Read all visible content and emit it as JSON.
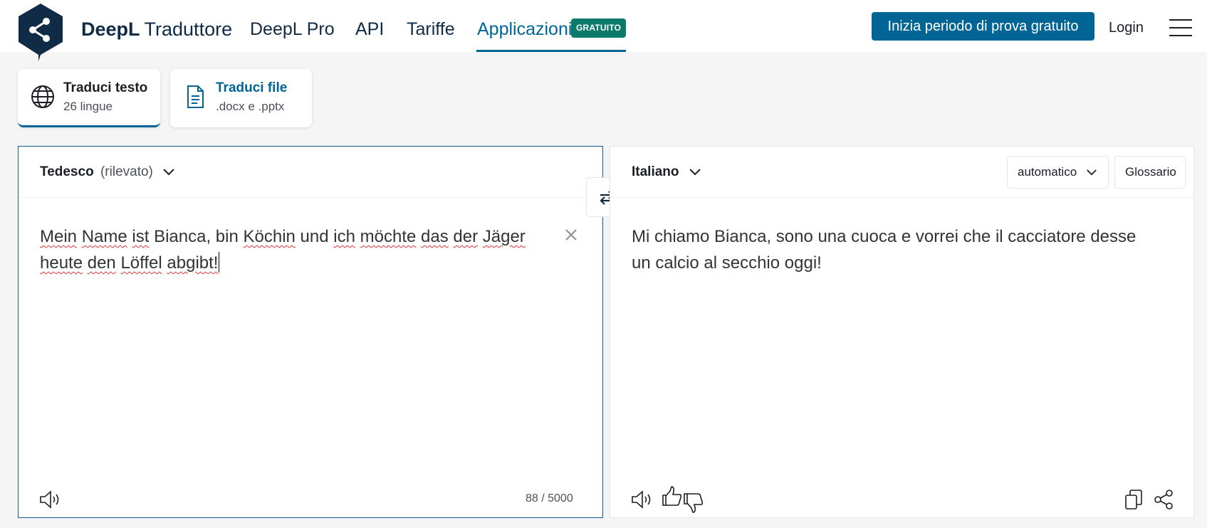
{
  "header": {
    "brand_bold": "DeepL",
    "brand_light": "Traduttore",
    "nav": {
      "pro": "DeepL Pro",
      "api": "API",
      "pricing": "Tariffe",
      "apps": "Applicazioni"
    },
    "apps_badge": "GRATUITO",
    "cta": "Inizia periodo di prova gratuito",
    "login": "Login"
  },
  "modes": {
    "text": {
      "title": "Traduci testo",
      "subtitle": "26 lingue",
      "icon": "globe-icon"
    },
    "file": {
      "title": "Traduci file",
      "subtitle": ".docx e .pptx",
      "icon": "document-icon"
    }
  },
  "source": {
    "language": "Tedesco",
    "detected_note": "(rilevato)",
    "words": [
      "Mein",
      " ",
      "Name",
      " ",
      "ist",
      " Bianca, bin ",
      "Köchin",
      " und ",
      "ich",
      " ",
      "möchte",
      " ",
      "das",
      " ",
      "der",
      " ",
      "Jäger",
      " ",
      "heute",
      " ",
      "den",
      " ",
      "Löffel",
      " ",
      "abgibt!"
    ],
    "char_count": "88 / 5000"
  },
  "target": {
    "language": "Italiano",
    "text": "Mi chiamo Bianca, sono una cuoca e vorrei che il cacciatore desse un calcio al secchio oggi!",
    "formality": "automatico",
    "glossary": "Glossario"
  },
  "colors": {
    "accent": "#006494",
    "brand_dark": "#0f2b46",
    "badge": "#0b7a6a",
    "spellcheck": "#e23232"
  }
}
